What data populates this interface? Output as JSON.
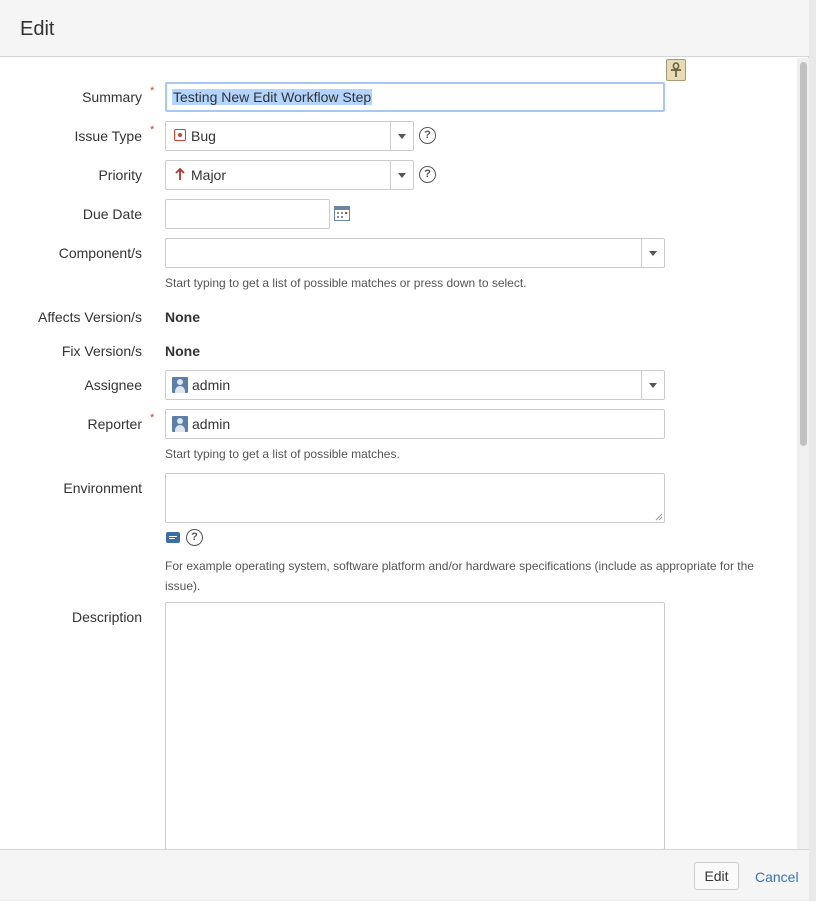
{
  "dialog": {
    "title": "Edit"
  },
  "fields": {
    "summary": {
      "label": "Summary",
      "value": "Testing New Edit Workflow Step"
    },
    "issue_type": {
      "label": "Issue Type",
      "value": "Bug",
      "icon": "bug-icon"
    },
    "priority": {
      "label": "Priority",
      "value": "Major",
      "icon": "priority-major-icon"
    },
    "due_date": {
      "label": "Due Date",
      "value": ""
    },
    "components": {
      "label": "Component/s",
      "value": "",
      "hint": "Start typing to get a list of possible matches or press down to select."
    },
    "affects_version": {
      "label": "Affects Version/s",
      "value": "None"
    },
    "fix_version": {
      "label": "Fix Version/s",
      "value": "None"
    },
    "assignee": {
      "label": "Assignee",
      "value": "admin"
    },
    "reporter": {
      "label": "Reporter",
      "value": "admin",
      "hint": "Start typing to get a list of possible matches."
    },
    "environment": {
      "label": "Environment",
      "value": "",
      "hint": "For example operating system, software platform and/or hardware specifications (include as appropriate for the issue)."
    },
    "description": {
      "label": "Description",
      "value": ""
    }
  },
  "required_marker": "*",
  "help_glyph": "?",
  "footer": {
    "edit_label": "Edit",
    "cancel_label": "Cancel"
  },
  "colors": {
    "accent_link": "#3b73af",
    "required": "#d04437",
    "selection": "#b3d4fc"
  }
}
